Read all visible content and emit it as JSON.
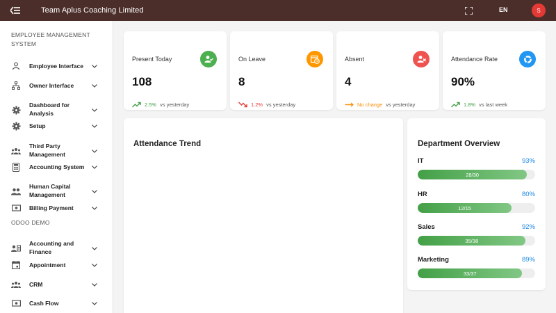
{
  "header": {
    "title": "Team Aplus Coaching Limited",
    "language": "EN",
    "avatar_initial": "S"
  },
  "sidebar": {
    "sections": [
      {
        "title": "EMPLOYEE MANAGEMENT SYSTEM",
        "items": [
          {
            "label": "Employee Interface",
            "icon": "user-icon"
          },
          {
            "label": "Owner Interface",
            "icon": "org-chart-icon"
          },
          {
            "label": "Dashboard for Analysis",
            "icon": "gear-icon"
          },
          {
            "label": "Setup",
            "icon": "gear-icon"
          },
          {
            "label": "Third Party Management",
            "icon": "group-icon"
          },
          {
            "label": "Accounting System",
            "icon": "calculator-icon"
          },
          {
            "label": "Human Capital Management",
            "icon": "people-icon"
          },
          {
            "label": "Billing Payment",
            "icon": "money-icon"
          }
        ]
      },
      {
        "title": "ODOO DEMO",
        "items": [
          {
            "label": "Accounting and Finance",
            "icon": "contact-icon"
          },
          {
            "label": "Appointment",
            "icon": "calendar-icon"
          },
          {
            "label": "CRM",
            "icon": "group-icon"
          },
          {
            "label": "Cash Flow",
            "icon": "money-icon"
          }
        ]
      }
    ]
  },
  "stats": [
    {
      "label": "Present Today",
      "value": "108",
      "trend_value": "2.5%",
      "trend_note": "vs yesterday",
      "trend": "up",
      "color": "#4caf50",
      "trend_color": "#43a047",
      "icon": "user-check-icon"
    },
    {
      "label": "On Leave",
      "value": "8",
      "trend_value": "1.2%",
      "trend_note": "vs yesterday",
      "trend": "down",
      "color": "#ff9800",
      "trend_color": "#e53935",
      "icon": "calendar-clock-icon"
    },
    {
      "label": "Absent",
      "value": "4",
      "trend_value": "No change",
      "trend_note": "vs yesterday",
      "trend": "flat",
      "color": "#ef5350",
      "trend_color": "#fb8c00",
      "icon": "user-x-icon"
    },
    {
      "label": "Attendance Rate",
      "value": "90%",
      "trend_value": "1.8%",
      "trend_note": "vs last week",
      "trend": "up",
      "color": "#2196f3",
      "trend_color": "#43a047",
      "icon": "donut-chart-icon"
    }
  ],
  "attendance_trend": {
    "title": "Attendance Trend"
  },
  "department_overview": {
    "title": "Department Overview",
    "departments": [
      {
        "name": "IT",
        "percent": "93%",
        "count": "28/30",
        "fraction": 0.93
      },
      {
        "name": "HR",
        "percent": "80%",
        "count": "12/15",
        "fraction": 0.8
      },
      {
        "name": "Sales",
        "percent": "92%",
        "count": "35/38",
        "fraction": 0.92
      },
      {
        "name": "Marketing",
        "percent": "89%",
        "count": "33/37",
        "fraction": 0.89
      }
    ]
  },
  "colors": {
    "topbar": "#4b2e2a",
    "accent_blue": "#1e88e5",
    "progress_green": "#43a047"
  }
}
